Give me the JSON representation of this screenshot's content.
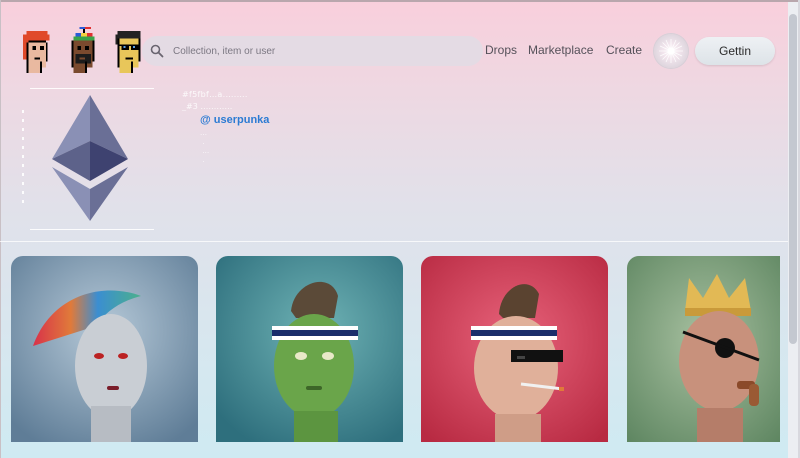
{
  "header": {
    "search": {
      "placeholder": "Collection, item or user",
      "icon": "search-icon"
    },
    "nav": [
      {
        "label": "Drops"
      },
      {
        "label": "Marketplace"
      },
      {
        "label": "Create"
      }
    ],
    "cta_label": "Gettin"
  },
  "profile": {
    "meta_line_1": "#f5fbf…a.….….",
    "meta_line_2": "_#3 …………",
    "handle": "@ userpunka",
    "tick_lines": "…\n .\n …\n ."
  },
  "colors": {
    "accent_link": "#2b7bd3",
    "background_top": "#f9cfdc",
    "background_bottom": "#cfeaf2"
  },
  "cards": [
    {
      "name": "nft-card-rainbow-mohawk",
      "background": "#7f9bb4"
    },
    {
      "name": "nft-card-green-headband",
      "background": "#3d8791"
    },
    {
      "name": "nft-card-sunglasses-cigarette",
      "background": "#c9374e"
    },
    {
      "name": "nft-card-crown-eyepatch",
      "background": "#6e9a6c"
    }
  ]
}
